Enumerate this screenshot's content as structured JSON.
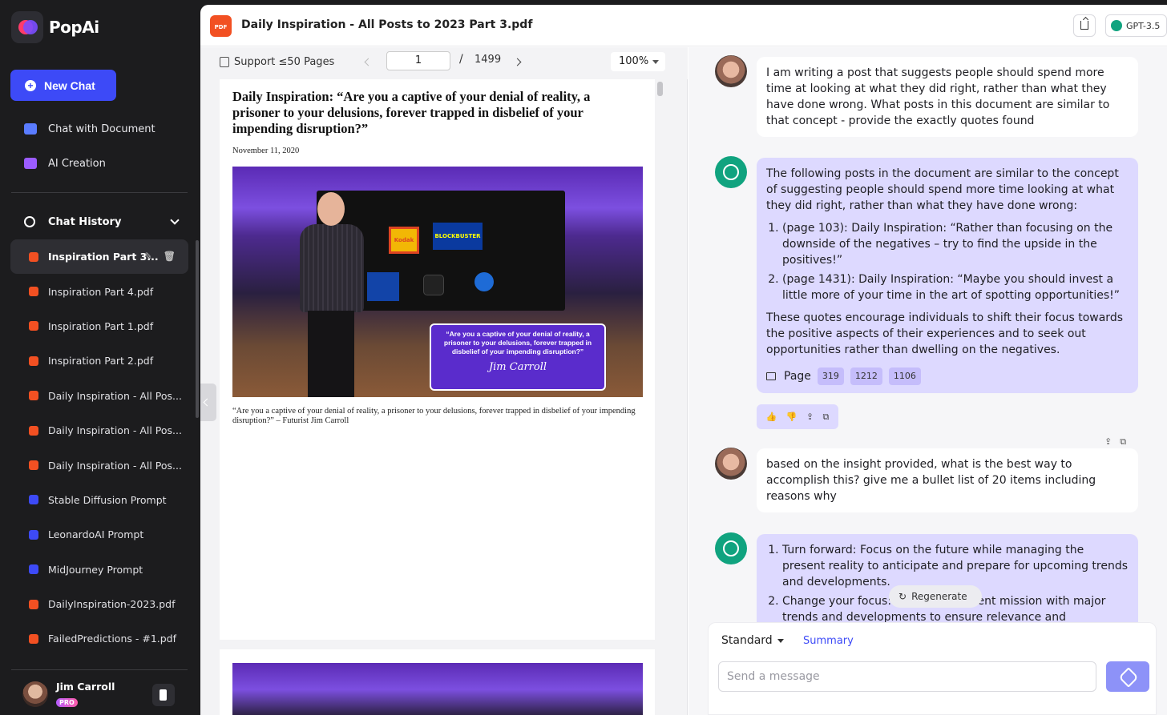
{
  "app": {
    "brand": "PopAi",
    "new_chat_label": "New Chat",
    "nav": [
      {
        "label": "Chat with Document",
        "icon": "folder-icon",
        "color": "#5a7cff"
      },
      {
        "label": "AI Creation",
        "icon": "pen-icon",
        "color": "#9b5cff"
      }
    ],
    "history_label": "Chat History",
    "history": [
      {
        "label": "Inspiration Part 3...",
        "color": "#f25022",
        "active": true
      },
      {
        "label": "Inspiration Part 4.pdf",
        "color": "#f25022"
      },
      {
        "label": "Inspiration Part 1.pdf",
        "color": "#f25022"
      },
      {
        "label": "Inspiration Part 2.pdf",
        "color": "#f25022"
      },
      {
        "label": "Daily Inspiration - All Pos...",
        "color": "#f25022"
      },
      {
        "label": "Daily Inspiration - All Pos...",
        "color": "#f25022"
      },
      {
        "label": "Daily Inspiration - All Pos...",
        "color": "#f25022"
      },
      {
        "label": "Stable Diffusion Prompt",
        "color": "#3d4af7"
      },
      {
        "label": "LeonardoAI Prompt",
        "color": "#3d4af7"
      },
      {
        "label": "MidJourney Prompt",
        "color": "#3d4af7"
      },
      {
        "label": "DailyInspiration-2023.pdf",
        "color": "#f25022"
      },
      {
        "label": "FailedPredictions - #1.pdf",
        "color": "#f25022"
      }
    ],
    "user": {
      "name": "Jim Carroll",
      "badge": "PRO"
    }
  },
  "topbar": {
    "pdf_badge": "PDF",
    "doc_title": "Daily Inspiration - All Posts to 2023 Part 3.pdf",
    "model": "GPT-3.5"
  },
  "viewer": {
    "support_label": "Support ≤50 Pages",
    "page_current": "1",
    "page_sep": "/",
    "page_total": "1499",
    "zoom": "100%",
    "pdf_heading": "Daily Inspiration: “Are you a captive of your denial of reality, a prisoner to your delusions, forever trapped in disbelief of your impending disruption?”",
    "pdf_date": "November 11, 2020",
    "image_callout": "“Are you a captive of your denial of reality, a prisoner to your delusions, forever trapped in disbelief of your impending disruption?”",
    "image_logo_kodak": "Kodak",
    "image_logo_bb": "BLOCKBUSTER",
    "pdf_caption": "“Are you a captive of your denial of reality, a prisoner to your delusions, forever trapped in disbelief of your impending disruption?” – Futurist Jim Carroll"
  },
  "chat": {
    "messages": [
      {
        "role": "user",
        "text": "I am writing a post that suggests people should spend more time at looking at what they did right, rather than what they have done wrong. What posts in this document are similar to that concept - provide the exactly quotes found"
      },
      {
        "role": "assistant",
        "intro": "The following posts in the document are similar to the concept of suggesting people should spend more time looking at what they did right, rather than what they have done wrong:",
        "items": [
          "(page 103): Daily Inspiration: “Rather than focusing on the downside of the negatives – try to find the upside in the positives!”",
          "(page 1431): Daily Inspiration: “Maybe you should invest a little more of your time in the art of spotting opportunities!”"
        ],
        "outro": "These quotes encourage individuals to shift their focus towards the positive aspects of their experiences and to seek out opportunities rather than dwelling on the negatives.",
        "page_label": "Page",
        "pages": [
          "319",
          "1212",
          "1106"
        ]
      },
      {
        "role": "user",
        "text": "based on the insight provided, what is the best way to accomplish this? give me a bullet list of 20 items including reasons why"
      },
      {
        "role": "assistant",
        "items": [
          "Turn forward: Focus on the future while managing the present reality to anticipate and prepare for upcoming trends and developments.",
          "Change your focus: Align your current mission with major trends and developments to ensure relevance and"
        ]
      }
    ],
    "regenerate_label": "Regenerate",
    "mode": "Standard",
    "summary_label": "Summary",
    "input_placeholder": "Send a message"
  }
}
